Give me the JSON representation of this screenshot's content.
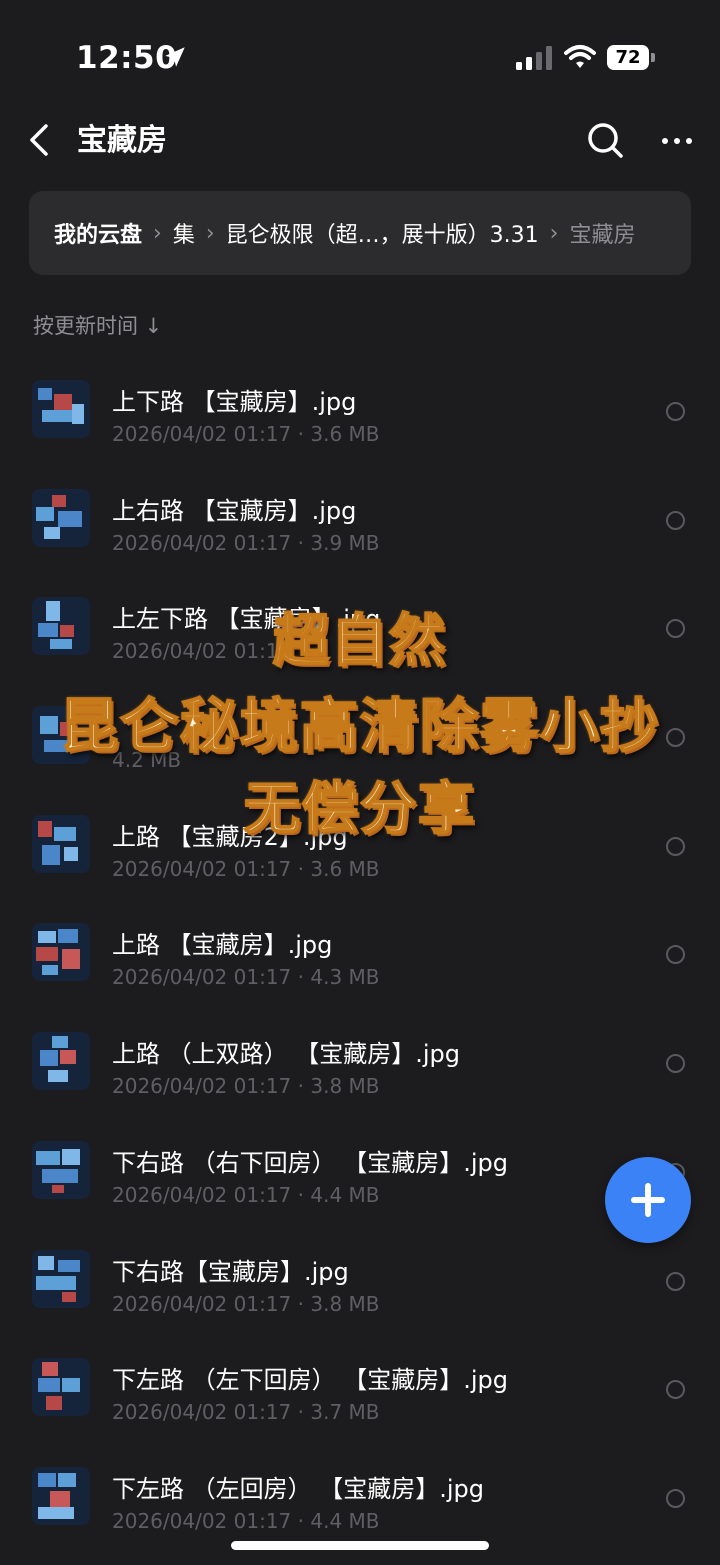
{
  "status_bar": {
    "time": "12:50",
    "battery": "72"
  },
  "nav": {
    "title": "宝藏房"
  },
  "breadcrumb": {
    "items": [
      "我的云盘",
      "集",
      "昆仑极限（超…，展十版）3.31",
      "宝藏房"
    ]
  },
  "sort": {
    "label": "按更新时间 ↓"
  },
  "files": [
    {
      "name": "上下路 【宝藏房】.jpg",
      "date": "2026/04/02 01:17",
      "size": "3.6 MB"
    },
    {
      "name": "上右路 【宝藏房】.jpg",
      "date": "2026/04/02 01:17",
      "size": "3.9 MB"
    },
    {
      "name": "上左下路 【宝藏房】.jpg",
      "date": "2026/04/02 01:17",
      "size": ""
    },
    {
      "name": "",
      "date": "",
      "size": "4.2 MB"
    },
    {
      "name": "上路 【宝藏房2】.jpg",
      "date": "2026/04/02 01:17",
      "size": "3.6 MB"
    },
    {
      "name": "上路 【宝藏房】.jpg",
      "date": "2026/04/02 01:17",
      "size": "4.3 MB"
    },
    {
      "name": "上路 （上双路） 【宝藏房】.jpg",
      "date": "2026/04/02 01:17",
      "size": "3.8 MB"
    },
    {
      "name": "下右路 （右下回房） 【宝藏房】.jpg",
      "date": "2026/04/02 01:17",
      "size": "4.4 MB"
    },
    {
      "name": "下右路【宝藏房】.jpg",
      "date": "2026/04/02 01:17",
      "size": "3.8 MB"
    },
    {
      "name": "下左路 （左下回房） 【宝藏房】.jpg",
      "date": "2026/04/02 01:17",
      "size": "3.7 MB"
    },
    {
      "name": "下左路 （左回房） 【宝藏房】.jpg",
      "date": "2026/04/02 01:17",
      "size": "4.4 MB"
    }
  ],
  "overlay": {
    "line1": "超自然",
    "line2": "昆仑秘境高清除雾小抄",
    "line3": "无偿分享"
  },
  "colors": {
    "background": "#1c1c1e",
    "breadcrumb_bg": "#2c2c2e",
    "fab": "#3b82f6",
    "overlay_text": "#fff3d9",
    "overlay_stroke": "#c77a1a"
  },
  "icons": [
    "back-chevron-icon",
    "search-icon",
    "more-icon",
    "location-arrow-icon",
    "signal-icon",
    "wifi-icon",
    "battery-icon",
    "plus-icon"
  ]
}
